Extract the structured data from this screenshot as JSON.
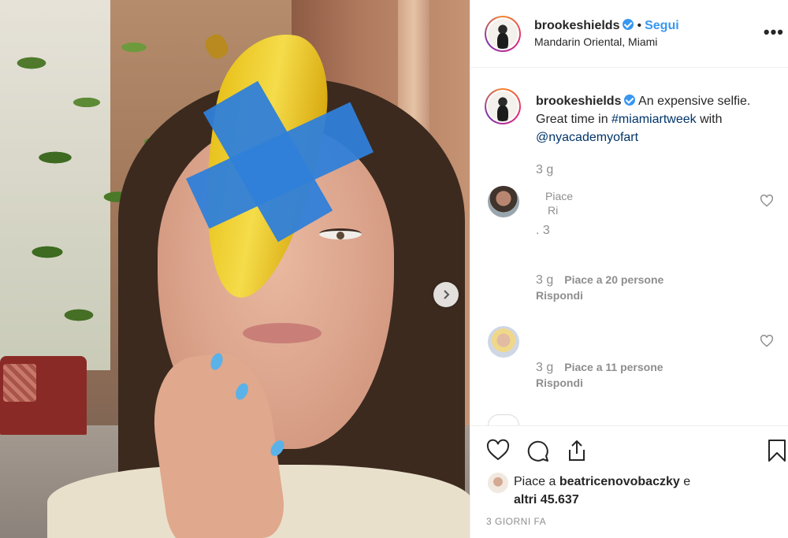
{
  "post": {
    "username": "brookeshields",
    "separator": "•",
    "follow_label": "Segui",
    "location": "Mandarin Oriental, Miami",
    "more_label": "•••"
  },
  "caption": {
    "username": "brookeshields",
    "text_before": "An expensive selfie. Great time in ",
    "hashtag": "#miamiartweek",
    "text_middle": " with ",
    "mention": "@nyacademyofart",
    "age": "3 g"
  },
  "comments": [
    {
      "text_line1": "Piace",
      "text_line2": "Ri",
      "text_line3": ". 3",
      "age": "3 g",
      "likes": "Piace a 20 persone",
      "reply_label": "Rispondi"
    },
    {
      "age": "3 g",
      "likes": "Piace a 11 persone",
      "reply_label": "Rispondi"
    }
  ],
  "likes": {
    "prefix": "Piace a ",
    "user": "beatricenovobaczky",
    "suffix": " e",
    "others": "altri 45.637"
  },
  "timestamp": "3 GIORNI FA",
  "icons": {
    "like": "heart-icon",
    "comment": "comment-icon",
    "share": "share-icon",
    "save": "bookmark-icon",
    "next": "chevron-right-icon"
  },
  "colors": {
    "accent": "#3897f0",
    "link": "#003569",
    "muted": "#8e8e8e",
    "text": "#262626"
  }
}
